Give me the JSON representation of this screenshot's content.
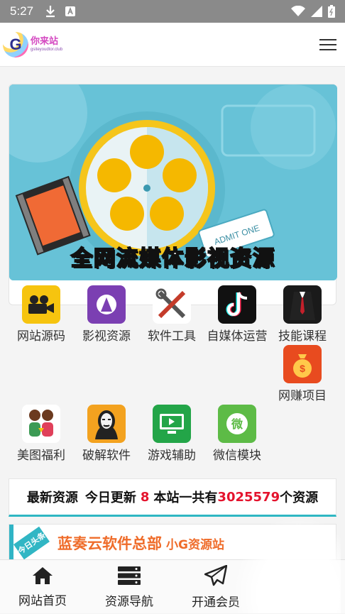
{
  "status_bar": {
    "time": "5:27",
    "icons": [
      "download-icon",
      "a-icon",
      "wifi-icon",
      "signal-icon",
      "battery-icon"
    ]
  },
  "header": {
    "logo_letter": "G",
    "logo_name": "你来站",
    "logo_domain": "gsiteyoudtor.club"
  },
  "banner": {
    "title": "全网流媒体影视资源"
  },
  "categories": [
    {
      "label": "网站源码",
      "icon": "video-camera-icon",
      "color": "#f6c40f"
    },
    {
      "label": "影视资源",
      "icon": "movie-stage-icon",
      "color": "#7b3fb2"
    },
    {
      "label": "软件工具",
      "icon": "wrench-screwdriver-icon",
      "color": "#ffffff"
    },
    {
      "label": "自媒体运营",
      "icon": "tiktok-icon",
      "color": "#111111"
    },
    {
      "label": "技能课程",
      "icon": "suit-icon",
      "color": "#1a1a1a"
    },
    {
      "label": "网赚项目",
      "icon": "money-bag-icon",
      "color": "#e84b1f"
    },
    {
      "label": "美图福利",
      "icon": "couple-icon",
      "color": "#ffffff"
    },
    {
      "label": "破解软件",
      "icon": "hacker-mask-icon",
      "color": "#f3a21f"
    },
    {
      "label": "游戏辅助",
      "icon": "monitor-icon",
      "color": "#23a548"
    },
    {
      "label": "微信模块",
      "icon": "wechat-icon",
      "color": "#5dbb46"
    }
  ],
  "notice": {
    "prefix": "最新资源",
    "today_label": "今日更新",
    "today_count": "8",
    "total_label": "本站一共有",
    "total_count": "3025579",
    "suffix": "个资源"
  },
  "feature": {
    "ribbon": "今日头条",
    "title": "蓝奏云软件总部",
    "subtitle": "小G资源站"
  },
  "bottom_nav": [
    {
      "label": "网站首页",
      "icon": "home-icon"
    },
    {
      "label": "资源导航",
      "icon": "server-list-icon"
    },
    {
      "label": "开通会员",
      "icon": "paper-plane-icon"
    }
  ]
}
